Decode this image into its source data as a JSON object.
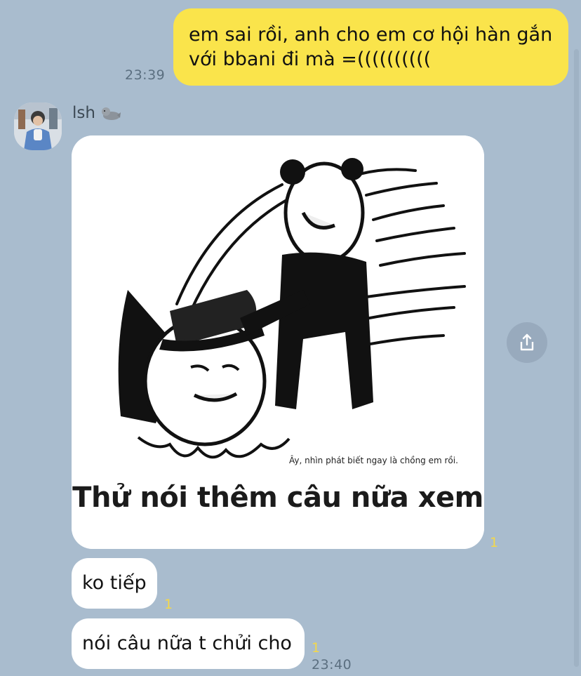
{
  "outgoing": {
    "text_line1": "em sai rồi, anh cho em cơ hội hàn gắn",
    "text_line2": "với bbani đi mà =((((((((((",
    "time": "23:39"
  },
  "sender": {
    "name": "lsh",
    "emoji_icon": "seal-icon"
  },
  "image_message": {
    "small_caption": "Ây, nhìn phát biết ngay là chồng em rồi.",
    "caption": "Thử nói thêm câu nữa xem",
    "read_count": "1"
  },
  "incoming": [
    {
      "text": "ko tiếp",
      "read_count": "1"
    },
    {
      "text": "nói câu nữa t chửi cho",
      "read_count": "1",
      "time": "23:40"
    }
  ],
  "colors": {
    "background": "#a9bcce",
    "outgoing_bubble": "#fae44b",
    "incoming_bubble": "#ffffff",
    "read_count": "#f4d84a"
  },
  "share_button_icon": "share-icon"
}
